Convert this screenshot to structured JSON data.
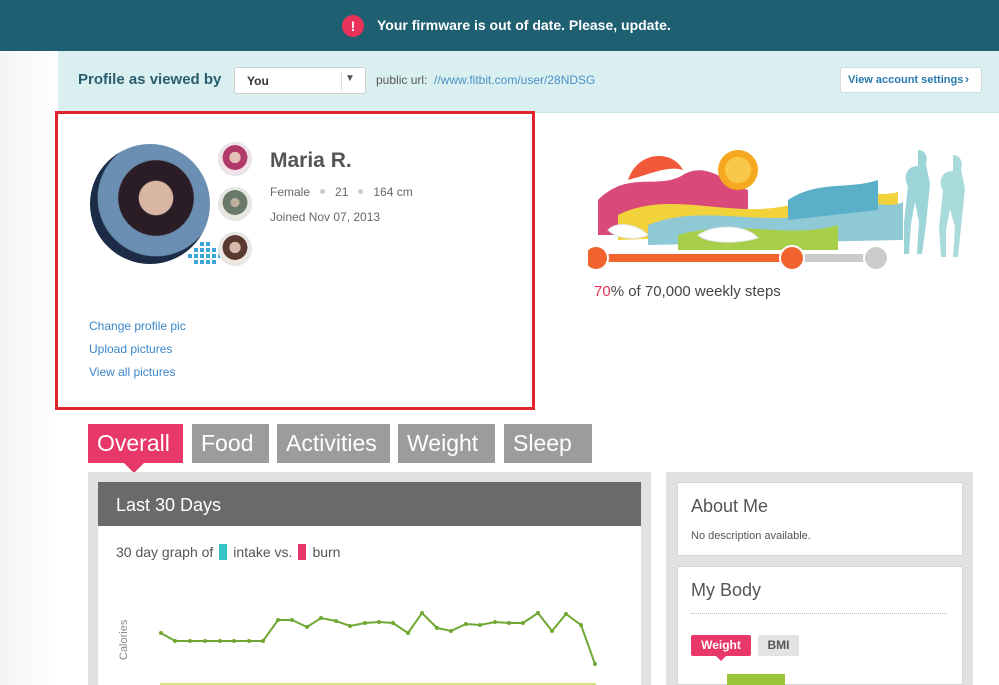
{
  "banner": {
    "icon": "alert-icon",
    "text": "Your firmware is out of date. Please, update."
  },
  "profile_bar": {
    "label": "Profile as viewed by",
    "viewer_select": "You",
    "public_url_label": "public url:",
    "public_url": "//www.fitbit.com/user/28NDSG",
    "account_button": "View account settings"
  },
  "profile": {
    "name": "Maria R.",
    "gender": "Female",
    "age": "21",
    "height": "164 cm",
    "joined": "Joined Nov 07, 2013",
    "links": [
      "Change profile pic",
      "Upload pictures",
      "View all pictures"
    ]
  },
  "steps": {
    "percent": "70",
    "suffix": "% of 70,000 weekly steps",
    "progress_fraction": 0.7
  },
  "tabs": [
    "Overall",
    "Food",
    "Activities",
    "Weight",
    "Sleep"
  ],
  "overview": {
    "title": "Last 30 Days",
    "caption_prefix": "30 day graph of",
    "intake_label": "intake vs.",
    "burn_label": "burn",
    "y_label": "Calories",
    "colors": {
      "intake": "#35c4c4",
      "burn": "#e8386a",
      "line": "#6fa834"
    }
  },
  "about": {
    "title": "About Me",
    "description": "No description available."
  },
  "my_body": {
    "title": "My Body",
    "tabs": [
      "Weight",
      "BMI"
    ]
  },
  "colors": {
    "banner": "#1e5f72",
    "accent": "#e8386a",
    "link": "#3a86c8"
  }
}
